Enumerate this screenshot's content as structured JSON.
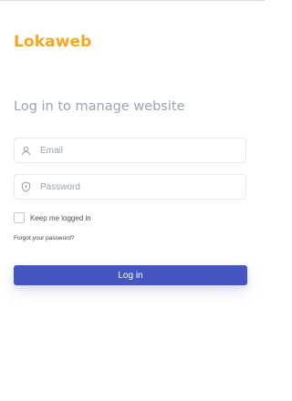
{
  "brand": {
    "logo_text": "Lokaweb",
    "color": "#f5a623"
  },
  "login": {
    "heading": "Log in to manage website",
    "email_placeholder": "Email",
    "email_icon": "user-icon",
    "password_placeholder": "Password",
    "password_icon": "shield-icon",
    "remember_label": "Keep me logged in",
    "remember_checked": false,
    "forgot_link": "Forgot your password?",
    "submit_label": "Log in",
    "submit_color": "#4356c3"
  }
}
